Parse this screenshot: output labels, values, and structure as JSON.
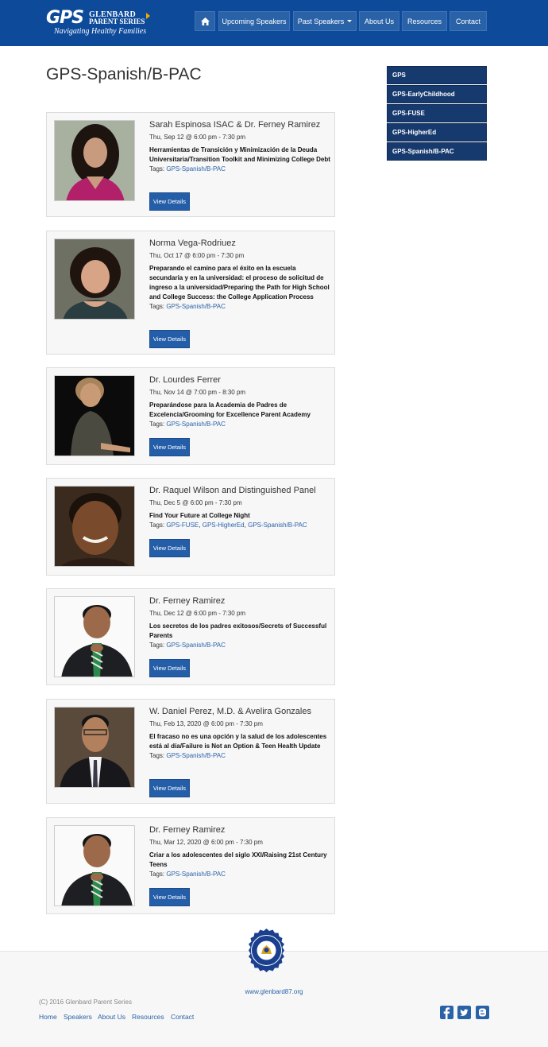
{
  "header": {
    "logo": {
      "gps": "GPS",
      "name_line1": "GLENBARD",
      "name_line2": "PARENT SERIES",
      "tagline": "Navigating Healthy Families"
    },
    "nav": {
      "home_icon": "home-icon",
      "upcoming": "Upcoming Speakers",
      "past": "Past Speakers",
      "about": "About Us",
      "resources": "Resources",
      "contact": "Contact"
    },
    "colors": {
      "bar": "#0d4a9a",
      "nav_button": "#2a62a8"
    }
  },
  "page_title": "GPS-Spanish/B-PAC",
  "sidebar": {
    "items": [
      "GPS",
      "GPS-EarlyChildhood",
      "GPS-FUSE",
      "GPS-HigherEd",
      "GPS-Spanish/B-PAC"
    ]
  },
  "events": [
    {
      "name": "Sarah Espinosa ISAC & Dr. Ferney Ramirez",
      "date": "Thu, Sep 12 @ 6:00 pm - 7:30 pm",
      "desc": "Herramientas de Transición y Minimización de la Deuda Universitaria/Transition Toolkit and Minimizing College Debt",
      "tags_label": "Tags:",
      "tags": [
        "GPS-Spanish/B-PAC"
      ],
      "button": "View Details"
    },
    {
      "name": "Norma Vega-Rodriuez",
      "date": "Thu, Oct 17 @ 6:00 pm - 7:30 pm",
      "desc": "Preparando el camino para el éxito en la escuela secundaria y en la universidad: el proceso de solicitud de ingreso a la universidad/Preparing the Path for High School and College Success: the College Application Process",
      "tags_label": "Tags:",
      "tags": [
        "GPS-Spanish/B-PAC"
      ],
      "button": "View Details"
    },
    {
      "name": "Dr. Lourdes Ferrer",
      "date": "Thu, Nov 14 @ 7:00 pm - 8:30 pm",
      "desc": "Preparándose para la Academia de Padres de Excelencia/Grooming for Excellence Parent Academy",
      "tags_label": "Tags:",
      "tags": [
        "GPS-Spanish/B-PAC"
      ],
      "button": "View Details"
    },
    {
      "name": "Dr. Raquel Wilson and Distinguished Panel",
      "date": "Thu, Dec 5 @ 6:00 pm - 7:30 pm",
      "desc": "Find Your Future at College Night",
      "tags_label": "Tags:",
      "tags": [
        "GPS-FUSE",
        "GPS-HigherEd",
        "GPS-Spanish/B-PAC"
      ],
      "button": "View Details"
    },
    {
      "name": "Dr. Ferney Ramirez",
      "date": "Thu, Dec 12 @ 6:00 pm - 7:30 pm",
      "desc": "Los secretos de los padres exitosos/Secrets of Successful Parents",
      "tags_label": "Tags:",
      "tags": [
        "GPS-Spanish/B-PAC"
      ],
      "button": "View Details"
    },
    {
      "name": "W. Daniel Perez, M.D. & Avelira Gonzales",
      "date": "Thu, Feb 13, 2020 @ 6:00 pm - 7:30 pm",
      "desc": "El fracaso no es una opción y la salud de los adolescentes está al día/Failure is Not an Option & Teen Health Update",
      "tags_label": "Tags:",
      "tags": [
        "GPS-Spanish/B-PAC"
      ],
      "button": "View Details"
    },
    {
      "name": "Dr. Ferney Ramirez",
      "date": "Thu, Mar 12, 2020 @ 6:00 pm - 7:30 pm",
      "desc": "Criar a los adolescentes del siglo XXI/Raising 21st Century Teens",
      "tags_label": "Tags:",
      "tags": [
        "GPS-Spanish/B-PAC"
      ],
      "button": "View Details"
    }
  ],
  "footer": {
    "url": "www.glenbard87.org",
    "copyright": "(C) 2016 Glenbard Parent Series",
    "links": [
      "Home",
      "Speakers",
      "About Us",
      "Resources",
      "Contact"
    ],
    "social_icons": [
      "facebook-icon",
      "twitter-icon",
      "blogger-icon"
    ]
  }
}
